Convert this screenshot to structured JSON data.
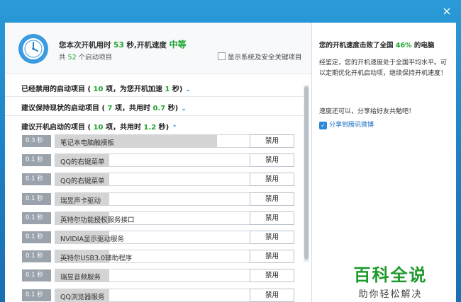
{
  "window": {
    "close_glyph": "×"
  },
  "header": {
    "line1_a": "您本次开机用时",
    "seconds": "53",
    "line1_b": "秒,开机速度",
    "speed_rating": "中等",
    "line2_a": "共",
    "count": "52",
    "line2_b": "个启动项目",
    "show_system_label": "显示系统及安全关键项目"
  },
  "sections": [
    {
      "a": "已经禁用的启动项目 (",
      "n1": "10",
      "b": "项，为您开机加速",
      "n2": "1",
      "c": "秒)",
      "chevron": "⌄"
    },
    {
      "a": "建议保持现状的启动项目 (",
      "n1": "7",
      "b": "项，共用时",
      "n2": "0.7",
      "c": "秒)",
      "chevron": "⌄"
    },
    {
      "a": "建议开机启动的项目 (",
      "n1": "10",
      "b": "项，共用时",
      "n2": "1.2",
      "c": "秒)",
      "chevron": "⌃"
    }
  ],
  "items": [
    {
      "time": "0.3 秒",
      "name": "笔记本电脑触摸板",
      "button": "禁用",
      "load": 0.9
    },
    {
      "time": "0.1 秒",
      "name": "QQ的右键菜单",
      "button": "禁用",
      "load": 0.3
    },
    {
      "time": "0.1 秒",
      "name": "QQ的右键菜单",
      "button": "禁用",
      "load": 0.3
    },
    {
      "time": "0.1 秒",
      "name": "瑞昱声卡驱动",
      "button": "禁用",
      "load": 0.3
    },
    {
      "time": "0.1 秒",
      "name": "英特尔功能授权服务接口",
      "button": "禁用",
      "load": 0.3
    },
    {
      "time": "0.1 秒",
      "name": "NVIDIA显示驱动服务",
      "button": "禁用",
      "load": 0.3
    },
    {
      "time": "0.1 秒",
      "name": "英特尔USB3.0辅助程序",
      "button": "禁用",
      "load": 0.3
    },
    {
      "time": "0.1 秒",
      "name": "瑞昱音频服务",
      "button": "禁用",
      "load": 0.3
    },
    {
      "time": "0.1 秒",
      "name": "QQ浏览器服务",
      "button": "禁用",
      "load": 0.3
    }
  ],
  "right": {
    "title_a": "您的开机速度击败了全国",
    "percent": "46%",
    "title_b": "的电脑",
    "description": "经鉴定，您的开机速度处于全国平均水平。可以定期优化开机启动项，继续保持开机速度！",
    "share_text": "速度还可以，分享给好友共勉吧！",
    "share_link": "分享到腾讯微博"
  },
  "watermark": {
    "big": "百科全说",
    "small": "助你轻松解决"
  },
  "colors": {
    "accent_green": "#1aa32a",
    "title_blue": "#1d7fc4",
    "link_blue": "#1a6fc4"
  }
}
